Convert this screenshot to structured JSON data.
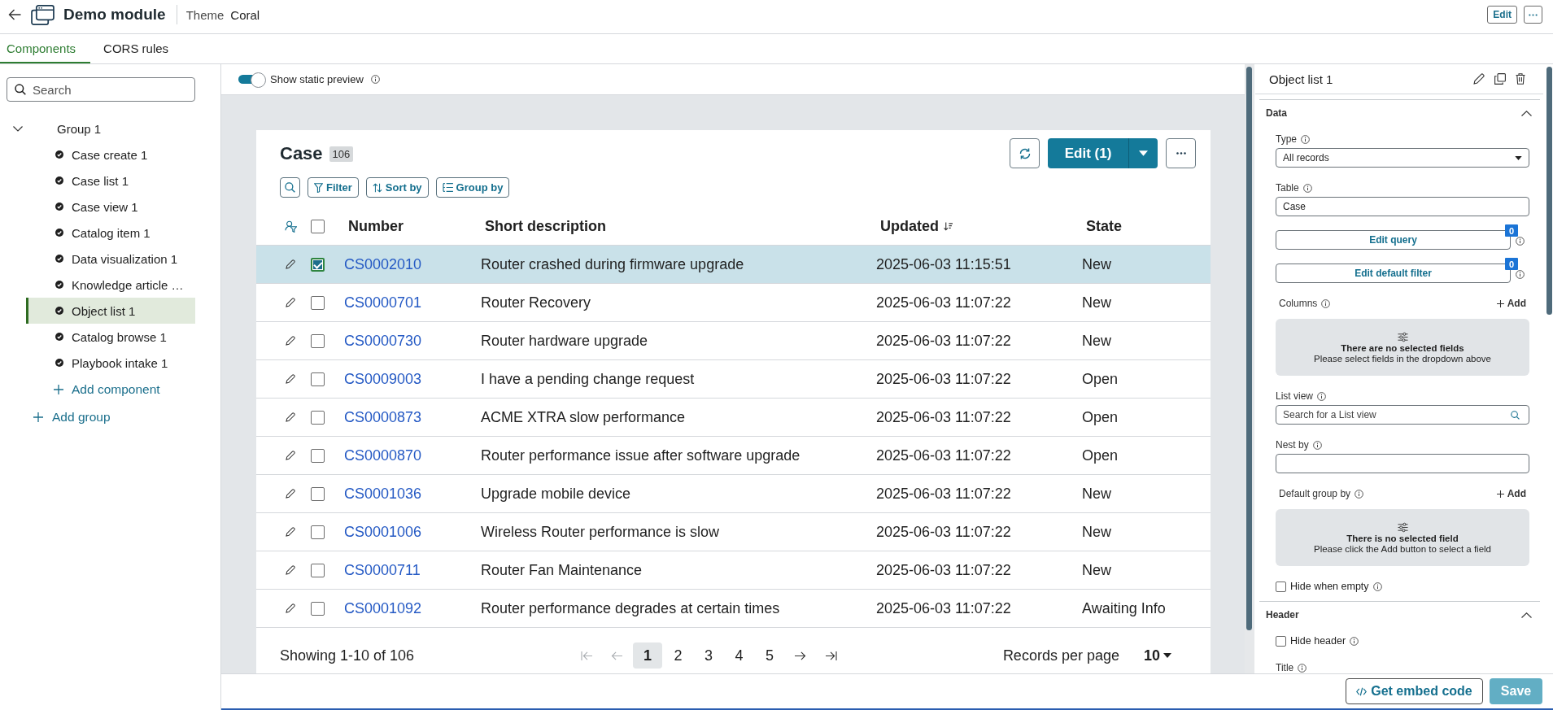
{
  "header": {
    "title": "Demo module",
    "theme_label": "Theme",
    "theme_value": "Coral",
    "edit_label": "Edit"
  },
  "tabs": [
    {
      "label": "Components",
      "selected": true
    },
    {
      "label": "CORS rules",
      "selected": false
    }
  ],
  "sidebar": {
    "search": {
      "placeholder": "Search"
    },
    "tree": [
      {
        "label": "Group 1",
        "expanded": true,
        "children": [
          {
            "label": "Case create 1",
            "selected": false
          },
          {
            "label": "Case list 1",
            "selected": false
          },
          {
            "label": "Case view 1",
            "selected": false
          },
          {
            "label": "Catalog item 1",
            "selected": false
          },
          {
            "label": "Data visualization 1",
            "selected": false
          },
          {
            "label": "Knowledge article …",
            "selected": false
          },
          {
            "label": "Object list 1",
            "selected": true
          },
          {
            "label": "Catalog browse 1",
            "selected": false
          },
          {
            "label": "Playbook intake 1",
            "selected": false
          }
        ],
        "add_label": "Add component"
      }
    ],
    "add_group": "Add group"
  },
  "preview": {
    "toggle": {
      "label": "Show static preview",
      "on": true,
      "info": true
    }
  },
  "list": {
    "title": "Case",
    "count": "106",
    "primary_action": "Edit (1)",
    "toolbar": [
      {
        "kind": "search"
      },
      {
        "kind": "filter",
        "label": "Filter"
      },
      {
        "kind": "sort",
        "label": "Sort by"
      },
      {
        "kind": "group",
        "label": "Group by"
      }
    ],
    "select_all": {
      "checked": false
    },
    "columns": [
      {
        "label": "Number",
        "sorted": false
      },
      {
        "label": "Short description",
        "sorted": false
      },
      {
        "label": "Updated",
        "sorted": true
      },
      {
        "label": "State",
        "sorted": false
      }
    ],
    "rows": [
      {
        "selected": true,
        "number": "CS0002010",
        "description": "Router crashed during firmware upgrade",
        "updated": "2025-06-03 11:15:51",
        "state": "New"
      },
      {
        "selected": false,
        "number": "CS0000701",
        "description": "Router Recovery",
        "updated": "2025-06-03 11:07:22",
        "state": "New"
      },
      {
        "selected": false,
        "number": "CS0000730",
        "description": "Router hardware upgrade",
        "updated": "2025-06-03 11:07:22",
        "state": "New"
      },
      {
        "selected": false,
        "number": "CS0009003",
        "description": "I have a pending change request",
        "updated": "2025-06-03 11:07:22",
        "state": "Open"
      },
      {
        "selected": false,
        "number": "CS0000873",
        "description": "ACME XTRA slow performance",
        "updated": "2025-06-03 11:07:22",
        "state": "Open"
      },
      {
        "selected": false,
        "number": "CS0000870",
        "description": "Router performance issue after software upgrade",
        "updated": "2025-06-03 11:07:22",
        "state": "Open"
      },
      {
        "selected": false,
        "number": "CS0001036",
        "description": "Upgrade mobile device",
        "updated": "2025-06-03 11:07:22",
        "state": "New"
      },
      {
        "selected": false,
        "number": "CS0001006",
        "description": "Wireless Router performance is slow",
        "updated": "2025-06-03 11:07:22",
        "state": "New"
      },
      {
        "selected": false,
        "number": "CS0000711",
        "description": "Router Fan Maintenance",
        "updated": "2025-06-03 11:07:22",
        "state": "New"
      },
      {
        "selected": false,
        "number": "CS0001092",
        "description": "Router performance degrades at certain times",
        "updated": "2025-06-03 11:07:22",
        "state": "Awaiting Info"
      }
    ],
    "pagination": {
      "summary": "Showing 1-10 of 106",
      "can_go_back": false,
      "can_go_forward": true,
      "pages": [
        {
          "label": "1",
          "selected": true
        },
        {
          "label": "2",
          "selected": false
        },
        {
          "label": "3",
          "selected": false
        },
        {
          "label": "4",
          "selected": false
        },
        {
          "label": "5",
          "selected": false
        }
      ],
      "per_page_label": "Records per page",
      "per_page": "10"
    }
  },
  "panel": {
    "title": "Object list 1",
    "sections": [
      {
        "title": "Data",
        "expanded": true,
        "fields": [
          {
            "kind": "select",
            "label": "Type",
            "info": true,
            "value": "All records"
          },
          {
            "kind": "text",
            "label": "Table",
            "info": true,
            "value": "Case"
          },
          {
            "kind": "button",
            "label": "Edit query",
            "info": true,
            "badge": "0"
          },
          {
            "kind": "button",
            "label": "Edit default filter",
            "info": true,
            "badge": "0"
          },
          {
            "kind": "list",
            "label": "Columns",
            "info": true,
            "add_label": "Add",
            "empty_title": "There are no selected fields",
            "empty_text": "Please select fields in the dropdown above"
          },
          {
            "kind": "search",
            "label": "List view",
            "info": true,
            "placeholder": "Search for a List view"
          },
          {
            "kind": "text",
            "label": "Nest by",
            "info": true
          },
          {
            "kind": "list",
            "label": "Default group by",
            "info": true,
            "add_label": "Add",
            "empty_title": "There is no selected field",
            "empty_text": "Please click the Add button to select a field"
          },
          {
            "kind": "checkbox",
            "label": "Hide when empty",
            "info": true,
            "checked": false
          }
        ]
      },
      {
        "title": "Header",
        "expanded": true,
        "fields": [
          {
            "kind": "checkbox",
            "label": "Hide header",
            "info": true,
            "checked": false
          },
          {
            "kind": "label",
            "label": "Title",
            "info": true
          }
        ]
      }
    ]
  },
  "footer": {
    "buttons": [
      {
        "kind": "secondary",
        "label": "Get embed code",
        "disabled": false
      },
      {
        "kind": "primary",
        "label": "Save",
        "disabled": true
      }
    ]
  }
}
